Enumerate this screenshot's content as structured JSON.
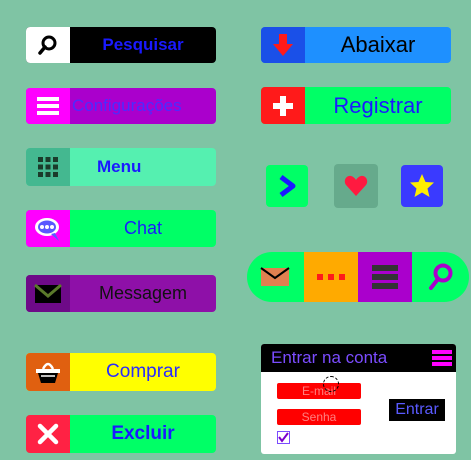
{
  "buttons": {
    "pesquisar": "Pesquisar",
    "configuracoes": "Configurações",
    "menu": "Menu",
    "chat": "Chat",
    "mensagem": "Messagem",
    "comprar": "Comprar",
    "excluir": "Excluir",
    "abaixar": "Abaixar",
    "registrar": "Registrar"
  },
  "login": {
    "title": "Entrar na conta",
    "email_label": "E-mail",
    "password_label": "Senha",
    "submit_label": "Entrar"
  },
  "colors": {
    "background": "#7fc4a4",
    "magenta": "#ff00ff",
    "purple": "#aa00cc",
    "green": "#00ff66",
    "mint": "#55f0b0",
    "yellow": "#ffff00",
    "red": "#ff0000",
    "blue": "#0080ff"
  },
  "icons": [
    "search-icon",
    "list-icon",
    "grid-icon",
    "chat-bubble-icon",
    "envelope-icon",
    "basket-icon",
    "x-icon",
    "down-arrow-icon",
    "plus-icon",
    "chevron-right-icon",
    "heart-icon",
    "star-icon",
    "ellipsis-icon",
    "magnifier-icon",
    "hamburger-icon",
    "checkbox-icon"
  ]
}
